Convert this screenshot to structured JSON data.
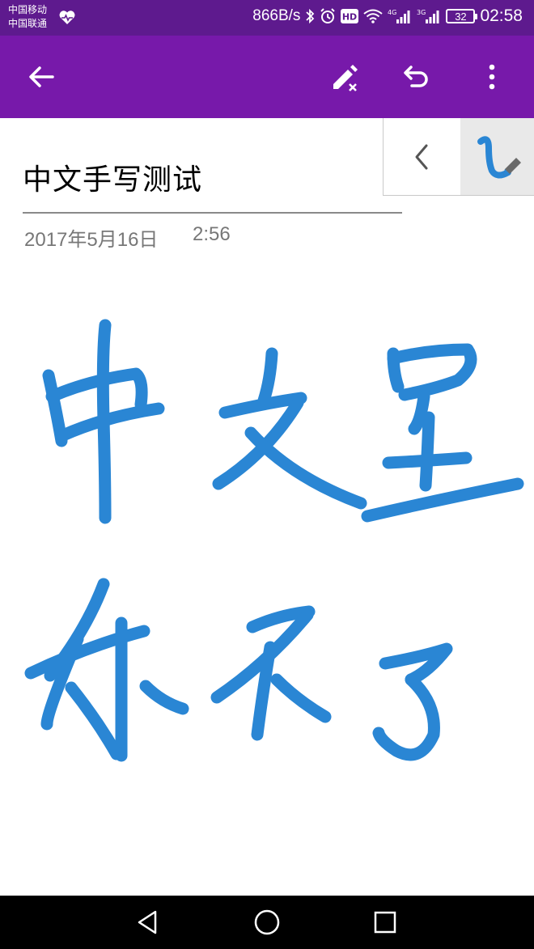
{
  "status_bar": {
    "carrier_1": "中国移动",
    "carrier_2": "中国联通",
    "network_speed": "866B/s",
    "signal_1_label": "4G",
    "signal_2_label": "3G",
    "battery": "32",
    "time": "02:58",
    "icons": [
      "heart-rate-icon",
      "bluetooth-icon",
      "alarm-icon",
      "hd-icon",
      "wifi-icon",
      "signal-icon",
      "battery-icon"
    ]
  },
  "app_bar": {
    "background": "#7719aa",
    "icons": [
      "back-arrow-icon",
      "eraser-icon",
      "undo-icon",
      "more-vert-icon"
    ]
  },
  "page": {
    "title": "中文手写测试",
    "date": "2017年5月16日",
    "time": "2:56"
  },
  "pen_toolbar": {
    "selected_pen_color": "#2a86d4",
    "icons": [
      "chevron-left-icon",
      "pen-stroke-icon"
    ]
  },
  "ink": {
    "color": "#2a86d4",
    "description": "handwritten strokes"
  },
  "nav_bar": {
    "icons": [
      "nav-back-icon",
      "nav-home-icon",
      "nav-recents-icon"
    ]
  }
}
